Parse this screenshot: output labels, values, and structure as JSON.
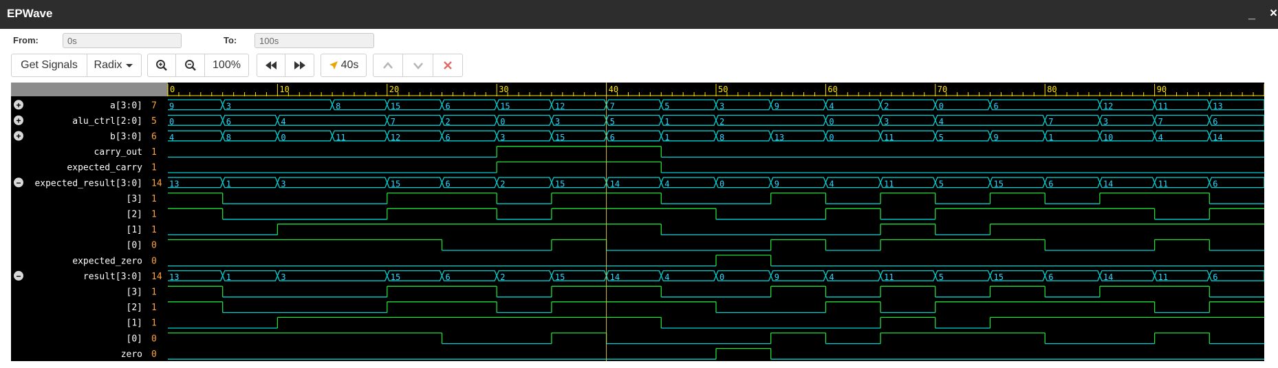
{
  "window": {
    "title": "EPWave",
    "minimize_glyph": "_",
    "close_glyph": "×"
  },
  "range": {
    "from_label": "From:",
    "from_value": "0s",
    "to_label": "To:",
    "to_value": "100s"
  },
  "toolbar": {
    "get_signals": "Get Signals",
    "radix": "Radix",
    "zoom_level": "100%",
    "cursor_time": "40s"
  },
  "colors": {
    "bus": "#00d2d2",
    "wave": "#22e038",
    "cursor": "#d7c44a",
    "timescale_bg": "#8c8c8c",
    "tick": "#ffe600",
    "value_text": "#ffa43a"
  },
  "timescale": {
    "start": 0,
    "end": 100,
    "labels": [
      0,
      10,
      20,
      30,
      40,
      50,
      60,
      70,
      80,
      90
    ],
    "cursor": 40
  },
  "signals": [
    {
      "name": "a[3:0]",
      "value": "7",
      "kind": "bus",
      "expander": "plus",
      "segments": [
        [
          0,
          "9"
        ],
        [
          5,
          "3"
        ],
        [
          15,
          "8"
        ],
        [
          20,
          "15"
        ],
        [
          25,
          "6"
        ],
        [
          30,
          "15"
        ],
        [
          35,
          "12"
        ],
        [
          40,
          "7"
        ],
        [
          45,
          "5"
        ],
        [
          50,
          "3"
        ],
        [
          55,
          "9"
        ],
        [
          60,
          "4"
        ],
        [
          65,
          "2"
        ],
        [
          70,
          "0"
        ],
        [
          75,
          "6"
        ],
        [
          85,
          "12"
        ],
        [
          90,
          "11"
        ],
        [
          95,
          "13"
        ]
      ]
    },
    {
      "name": "alu_ctrl[2:0]",
      "value": "5",
      "kind": "bus",
      "expander": "plus",
      "segments": [
        [
          0,
          "0"
        ],
        [
          5,
          "6"
        ],
        [
          10,
          "4"
        ],
        [
          20,
          "7"
        ],
        [
          25,
          "2"
        ],
        [
          30,
          "0"
        ],
        [
          35,
          "3"
        ],
        [
          40,
          "5"
        ],
        [
          45,
          "1"
        ],
        [
          50,
          "2"
        ],
        [
          60,
          "0"
        ],
        [
          65,
          "3"
        ],
        [
          70,
          "4"
        ],
        [
          80,
          "7"
        ],
        [
          85,
          "3"
        ],
        [
          90,
          "7"
        ],
        [
          95,
          "6"
        ]
      ]
    },
    {
      "name": "b[3:0]",
      "value": "6",
      "kind": "bus",
      "expander": "plus",
      "segments": [
        [
          0,
          "4"
        ],
        [
          5,
          "8"
        ],
        [
          10,
          "0"
        ],
        [
          15,
          "11"
        ],
        [
          20,
          "12"
        ],
        [
          25,
          "6"
        ],
        [
          30,
          "3"
        ],
        [
          35,
          "15"
        ],
        [
          40,
          "6"
        ],
        [
          45,
          "1"
        ],
        [
          50,
          "8"
        ],
        [
          55,
          "13"
        ],
        [
          60,
          "0"
        ],
        [
          65,
          "11"
        ],
        [
          70,
          "5"
        ],
        [
          75,
          "9"
        ],
        [
          80,
          "1"
        ],
        [
          85,
          "10"
        ],
        [
          90,
          "4"
        ],
        [
          95,
          "14"
        ]
      ]
    },
    {
      "name": "carry_out",
      "value": "1",
      "kind": "bit",
      "color": "green",
      "edges": [
        [
          0,
          0
        ],
        [
          30,
          1
        ],
        [
          45,
          0
        ]
      ]
    },
    {
      "name": "expected_carry",
      "value": "1",
      "kind": "bit",
      "color": "green",
      "edges": [
        [
          0,
          0
        ],
        [
          30,
          1
        ],
        [
          45,
          0
        ]
      ]
    },
    {
      "name": "expected_result[3:0]",
      "value": "14",
      "kind": "bus",
      "expander": "minus",
      "segments": [
        [
          0,
          "13"
        ],
        [
          5,
          "1"
        ],
        [
          10,
          "3"
        ],
        [
          20,
          "15"
        ],
        [
          25,
          "6"
        ],
        [
          30,
          "2"
        ],
        [
          35,
          "15"
        ],
        [
          40,
          "14"
        ],
        [
          45,
          "4"
        ],
        [
          50,
          "0"
        ],
        [
          55,
          "9"
        ],
        [
          60,
          "4"
        ],
        [
          65,
          "11"
        ],
        [
          70,
          "5"
        ],
        [
          75,
          "15"
        ],
        [
          80,
          "6"
        ],
        [
          85,
          "14"
        ],
        [
          90,
          "11"
        ],
        [
          95,
          "6"
        ]
      ]
    },
    {
      "name": "[3]",
      "value": "1",
      "kind": "bit",
      "edges": [
        [
          0,
          1
        ],
        [
          5,
          0
        ],
        [
          20,
          1
        ],
        [
          30,
          0
        ],
        [
          35,
          1
        ],
        [
          45,
          0
        ],
        [
          55,
          1
        ],
        [
          60,
          0
        ],
        [
          65,
          1
        ],
        [
          70,
          0
        ],
        [
          75,
          1
        ],
        [
          80,
          0
        ],
        [
          85,
          1
        ],
        [
          95,
          0
        ]
      ]
    },
    {
      "name": "[2]",
      "value": "1",
      "kind": "bit",
      "edges": [
        [
          0,
          1
        ],
        [
          5,
          0
        ],
        [
          20,
          1
        ],
        [
          30,
          0
        ],
        [
          35,
          1
        ],
        [
          50,
          0
        ],
        [
          60,
          1
        ],
        [
          65,
          0
        ],
        [
          70,
          1
        ],
        [
          90,
          0
        ],
        [
          95,
          1
        ]
      ]
    },
    {
      "name": "[1]",
      "value": "1",
      "kind": "bit",
      "edges": [
        [
          0,
          0
        ],
        [
          10,
          1
        ],
        [
          45,
          0
        ],
        [
          65,
          1
        ],
        [
          70,
          0
        ],
        [
          75,
          1
        ]
      ]
    },
    {
      "name": "[0]",
      "value": "0",
      "kind": "bit",
      "edges": [
        [
          0,
          1
        ],
        [
          25,
          0
        ],
        [
          35,
          1
        ],
        [
          40,
          0
        ],
        [
          55,
          1
        ],
        [
          60,
          0
        ],
        [
          65,
          1
        ],
        [
          80,
          0
        ],
        [
          90,
          1
        ],
        [
          95,
          0
        ]
      ]
    },
    {
      "name": "expected_zero",
      "value": "0",
      "kind": "bit",
      "edges": [
        [
          0,
          0
        ],
        [
          50,
          1
        ],
        [
          55,
          0
        ]
      ]
    },
    {
      "name": "result[3:0]",
      "value": "14",
      "kind": "bus",
      "expander": "minus",
      "segments": [
        [
          0,
          "13"
        ],
        [
          5,
          "1"
        ],
        [
          10,
          "3"
        ],
        [
          20,
          "15"
        ],
        [
          25,
          "6"
        ],
        [
          30,
          "2"
        ],
        [
          35,
          "15"
        ],
        [
          40,
          "14"
        ],
        [
          45,
          "4"
        ],
        [
          50,
          "0"
        ],
        [
          55,
          "9"
        ],
        [
          60,
          "4"
        ],
        [
          65,
          "11"
        ],
        [
          70,
          "5"
        ],
        [
          75,
          "15"
        ],
        [
          80,
          "6"
        ],
        [
          85,
          "14"
        ],
        [
          90,
          "11"
        ],
        [
          95,
          "6"
        ]
      ]
    },
    {
      "name": "[3]",
      "value": "1",
      "kind": "bit",
      "edges": [
        [
          0,
          1
        ],
        [
          5,
          0
        ],
        [
          20,
          1
        ],
        [
          30,
          0
        ],
        [
          35,
          1
        ],
        [
          45,
          0
        ],
        [
          55,
          1
        ],
        [
          60,
          0
        ],
        [
          65,
          1
        ],
        [
          70,
          0
        ],
        [
          75,
          1
        ],
        [
          80,
          0
        ],
        [
          85,
          1
        ],
        [
          95,
          0
        ]
      ]
    },
    {
      "name": "[2]",
      "value": "1",
      "kind": "bit",
      "edges": [
        [
          0,
          1
        ],
        [
          5,
          0
        ],
        [
          20,
          1
        ],
        [
          30,
          0
        ],
        [
          35,
          1
        ],
        [
          50,
          0
        ],
        [
          60,
          1
        ],
        [
          65,
          0
        ],
        [
          70,
          1
        ],
        [
          90,
          0
        ],
        [
          95,
          1
        ]
      ]
    },
    {
      "name": "[1]",
      "value": "1",
      "kind": "bit",
      "edges": [
        [
          0,
          0
        ],
        [
          10,
          1
        ],
        [
          45,
          0
        ],
        [
          65,
          1
        ],
        [
          70,
          0
        ],
        [
          75,
          1
        ]
      ]
    },
    {
      "name": "[0]",
      "value": "0",
      "kind": "bit",
      "edges": [
        [
          0,
          1
        ],
        [
          25,
          0
        ],
        [
          35,
          1
        ],
        [
          40,
          0
        ],
        [
          55,
          1
        ],
        [
          60,
          0
        ],
        [
          65,
          1
        ],
        [
          80,
          0
        ],
        [
          90,
          1
        ],
        [
          95,
          0
        ]
      ]
    },
    {
      "name": "zero",
      "value": "0",
      "kind": "bit",
      "edges": [
        [
          0,
          0
        ],
        [
          50,
          1
        ],
        [
          55,
          0
        ]
      ]
    }
  ]
}
